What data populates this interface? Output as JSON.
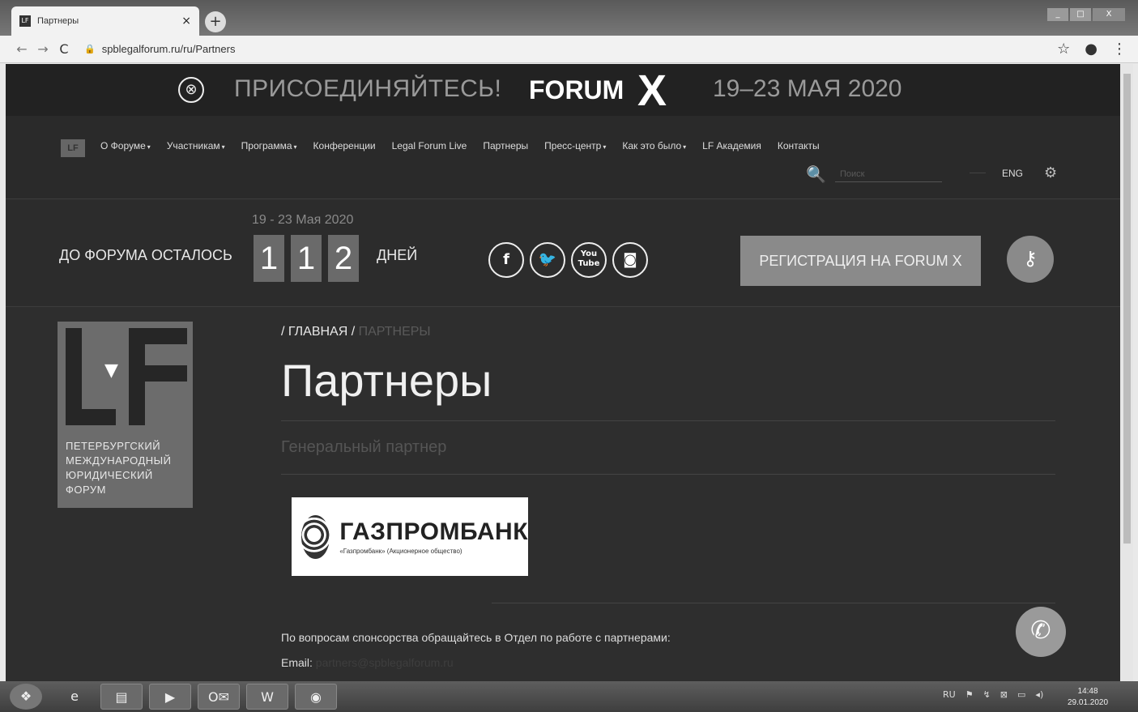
{
  "browser": {
    "tab_title": "Партнеры",
    "tab_favicon": "LF",
    "close_glyph": "×",
    "new_tab_glyph": "+",
    "url": "spblegalforum.ru/ru/Partners",
    "icons": {
      "back": "←",
      "forward": "→",
      "reload": "C",
      "lock": "🔒",
      "star": "☆",
      "account": "●",
      "menu": "⋮"
    },
    "window_controls": [
      "_",
      "□",
      "X"
    ]
  },
  "promo": {
    "close_glyph": "⊗",
    "join_text": "ПРИСОЕДИНЯЙТЕСЬ!",
    "forum_text": "FORUM",
    "x_text": "X",
    "dates_text": "19–23 МАЯ 2020"
  },
  "nav": {
    "logo": "LF",
    "items": [
      {
        "label": "О Форуме",
        "dropdown": true
      },
      {
        "label": "Участникам",
        "dropdown": true
      },
      {
        "label": "Программа",
        "dropdown": true
      },
      {
        "label": "Конференции",
        "dropdown": false
      },
      {
        "label": "Legal Forum Live",
        "dropdown": false
      },
      {
        "label": "Партнеры",
        "dropdown": false
      },
      {
        "label": "Пресс-центр",
        "dropdown": true
      },
      {
        "label": "Как это было",
        "dropdown": true
      },
      {
        "label": "LF Академия",
        "dropdown": false
      },
      {
        "label": "Контакты",
        "dropdown": false
      }
    ],
    "caret_glyph": "▾",
    "search_glyph": "🔍",
    "search_placeholder": "Поиск",
    "lang": "ENG",
    "settings_glyph": "⚙"
  },
  "countdown": {
    "date": "19 - 23 Мая 2020",
    "label": "ДО ФОРУМА ОСТАЛОСЬ",
    "digits": [
      "1",
      "1",
      "2"
    ],
    "days_label": "ДНЕЙ",
    "socials": [
      {
        "name": "facebook",
        "glyph": "f"
      },
      {
        "name": "twitter",
        "glyph": "🐦"
      },
      {
        "name": "youtube",
        "glyph": "You Tube"
      },
      {
        "name": "instagram",
        "glyph": "◙"
      }
    ],
    "register_label": "РЕГИСТРАЦИЯ НА FORUM X",
    "key_glyph": "⚷"
  },
  "sidebar_logo": {
    "arrow_glyph": "▼",
    "text_lines": [
      "ПЕТЕРБУРГСКИЙ",
      "МЕЖДУНАРОДНЫЙ",
      "ЮРИДИЧЕСКИЙ",
      "ФОРУМ"
    ]
  },
  "main": {
    "breadcrumb_home": "/ ГЛАВНАЯ /",
    "breadcrumb_current": "ПАРТНЕРЫ",
    "title": "Партнеры",
    "section_title": "Генеральный партнер",
    "sponsor_name": "ГАЗПРОМБАНК",
    "sponsor_sub": "«Газпромбанк» (Акционерное общество)",
    "contact_text": "По вопросам спонсорства обращайтесь в Отдел по работе с партнерами:",
    "email_label": "Email:",
    "email_value": "partners@spblegalforum.ru",
    "phone_glyph": "✆"
  },
  "taskbar": {
    "start_glyph": "❖",
    "apps": [
      {
        "name": "ie",
        "glyph": "e"
      },
      {
        "name": "explorer",
        "glyph": "▤"
      },
      {
        "name": "media",
        "glyph": "▶"
      },
      {
        "name": "outlook",
        "glyph": "O✉"
      },
      {
        "name": "word",
        "glyph": "W"
      },
      {
        "name": "chrome",
        "glyph": "◉"
      }
    ],
    "tray_lang": "RU",
    "tray_icons": [
      "⚑",
      "↯",
      "⊠",
      "▭",
      "◂)"
    ],
    "time": "14:48",
    "date": "29.01.2020"
  }
}
